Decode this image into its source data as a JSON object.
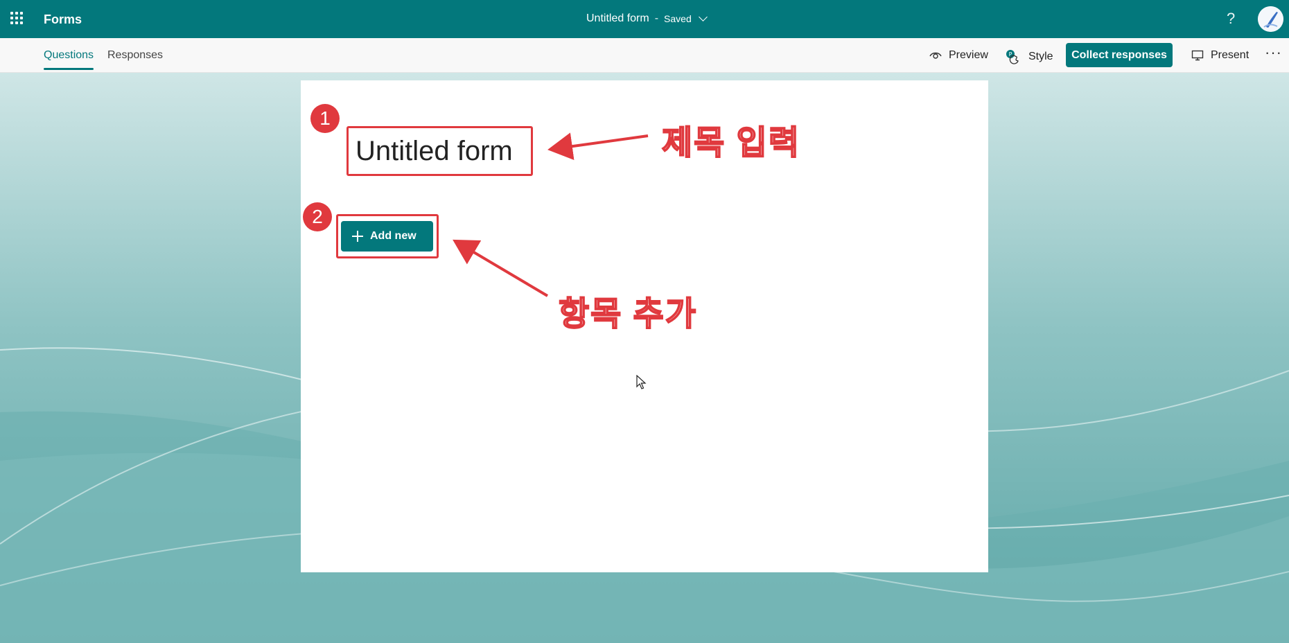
{
  "topbar": {
    "app_name": "Forms",
    "doc_title": "Untitled form",
    "separator": "-",
    "save_status": "Saved",
    "help_label": "?"
  },
  "tabs": [
    {
      "label": "Questions",
      "active": true
    },
    {
      "label": "Responses",
      "active": false
    }
  ],
  "commands": {
    "preview_label": "Preview",
    "style_label": "Style",
    "collect_label": "Collect responses",
    "present_label": "Present",
    "more_label": "···"
  },
  "form": {
    "title": "Untitled form",
    "add_new_label": "Add new"
  },
  "annotations": {
    "badge_1": "1",
    "badge_2": "2",
    "label_1": "제목 입력",
    "label_2": "항목 추가"
  },
  "colors": {
    "brand": "#03787c",
    "annotation_red": "#e0393e",
    "background": "#7fb8b8"
  },
  "icons": [
    "waffle-icon",
    "chevron-down-icon",
    "help-icon",
    "eye-icon",
    "palette-icon",
    "monitor-icon",
    "more-icon",
    "plus-icon",
    "mouse-cursor-icon"
  ]
}
